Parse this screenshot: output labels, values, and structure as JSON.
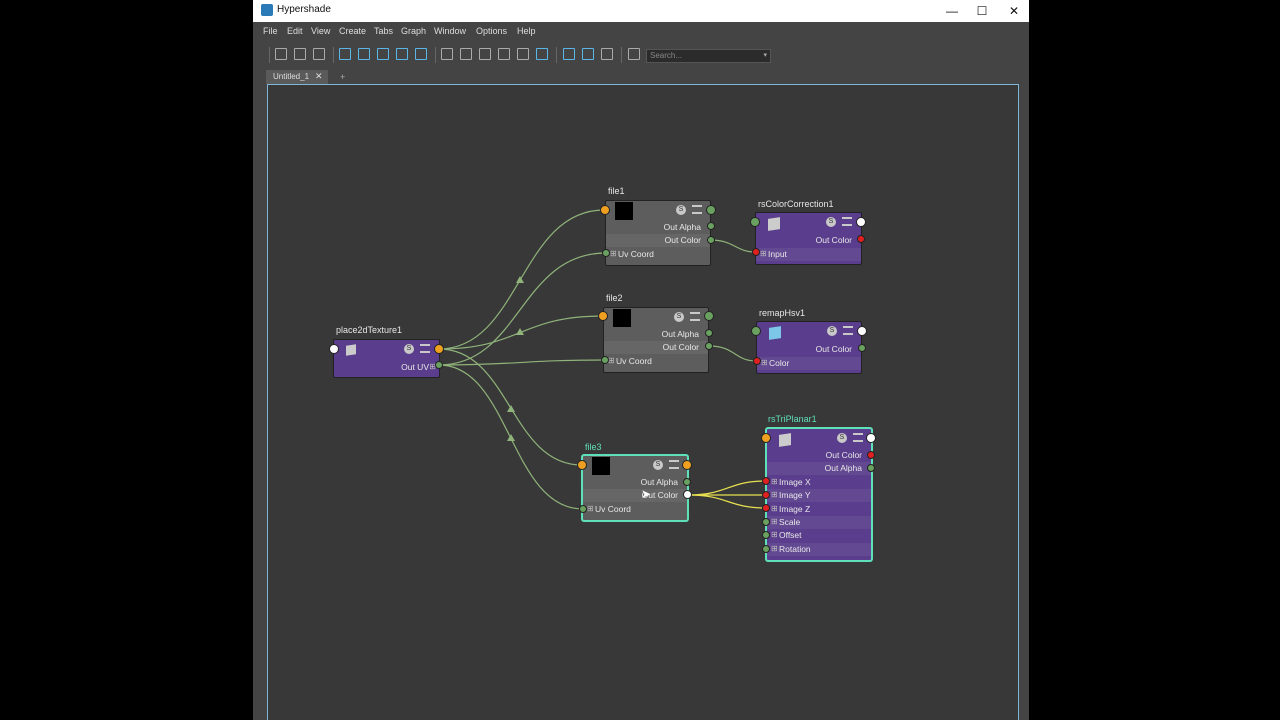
{
  "window": {
    "title": "Hypershade"
  },
  "window_controls": {
    "minimize": "—",
    "maximize": "☐",
    "close": "✕"
  },
  "menu": [
    "File",
    "Edit",
    "View",
    "Create",
    "Tabs",
    "Graph",
    "Window",
    "Options",
    "Help"
  ],
  "search": {
    "placeholder": "Search...",
    "caret": "▾"
  },
  "tabs": {
    "active_label": "Untitled_1",
    "close": "✕",
    "add": "+"
  },
  "nodes": {
    "place2dTexture1": {
      "name": "place2dTexture1",
      "out_uv": "Out UV",
      "badge": "S"
    },
    "file1": {
      "name": "file1",
      "out_alpha": "Out Alpha",
      "out_color": "Out Color",
      "uv_coord": "Uv Coord",
      "badge": "S"
    },
    "file2": {
      "name": "file2",
      "out_alpha": "Out Alpha",
      "out_color": "Out Color",
      "uv_coord": "Uv Coord",
      "badge": "S"
    },
    "file3": {
      "name": "file3",
      "out_alpha": "Out Alpha",
      "out_color": "Out Color",
      "uv_coord": "Uv Coord",
      "badge": "S"
    },
    "rsColorCorrection1": {
      "name": "rsColorCorrection1",
      "out_color": "Out Color",
      "input": "Input",
      "badge": "S"
    },
    "remapHsv1": {
      "name": "remapHsv1",
      "out_color": "Out Color",
      "color": "Color",
      "badge": "S"
    },
    "rsTriPlanar1": {
      "name": "rsTriPlanar1",
      "badge": "S",
      "out_color": "Out Color",
      "out_alpha": "Out Alpha",
      "image_x": "Image X",
      "image_y": "Image Y",
      "image_z": "Image Z",
      "scale": "Scale",
      "offset": "Offset",
      "rotation": "Rotation"
    }
  },
  "plus_glyph": "⊞",
  "colors": {
    "selection": "#5ee0b8",
    "wire": "#8fb37a",
    "wire_active": "#e8e050",
    "accent": "#5ab7e8"
  }
}
